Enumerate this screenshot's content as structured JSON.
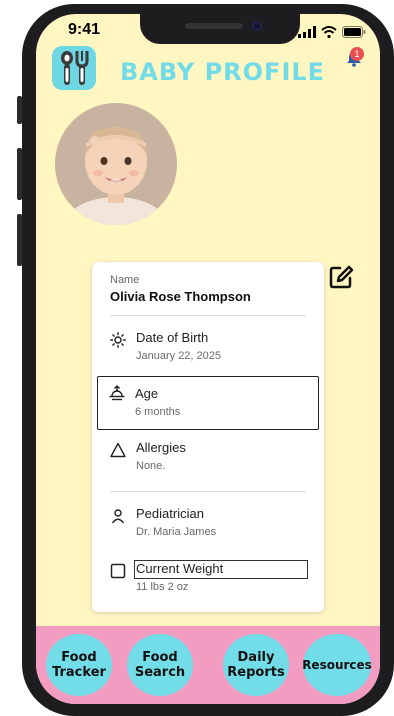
{
  "status": {
    "time": "9:41"
  },
  "header": {
    "title": "BABY PROFILE",
    "notification_count": "1"
  },
  "profile": {
    "name_label": "Name",
    "name": "Olivia Rose Thompson",
    "fields": [
      {
        "icon": "sun-icon",
        "label": "Date of Birth",
        "value": "January 22, 2025"
      },
      {
        "icon": "sunrise-icon",
        "label": "Age",
        "value": "6 months"
      },
      {
        "icon": "triangle-icon",
        "label": "Allergies",
        "value": "None."
      },
      {
        "icon": "person-icon",
        "label": "Pediatrician",
        "value": "Dr. Maria James"
      },
      {
        "icon": "checkbox-icon",
        "label": "Current Weight",
        "value": "11 lbs 2 oz"
      }
    ]
  },
  "nav": [
    {
      "line1": "Food",
      "line2": "Tracker"
    },
    {
      "line1": "Food",
      "line2": "Search"
    },
    {
      "line1": "Daily",
      "line2": "Reports"
    },
    {
      "line1": "Resources",
      "line2": ""
    }
  ],
  "colors": {
    "background": "#fff6c2",
    "accent": "#72dbe8",
    "nav_bar": "#f39cc2",
    "badge": "#e85050"
  }
}
